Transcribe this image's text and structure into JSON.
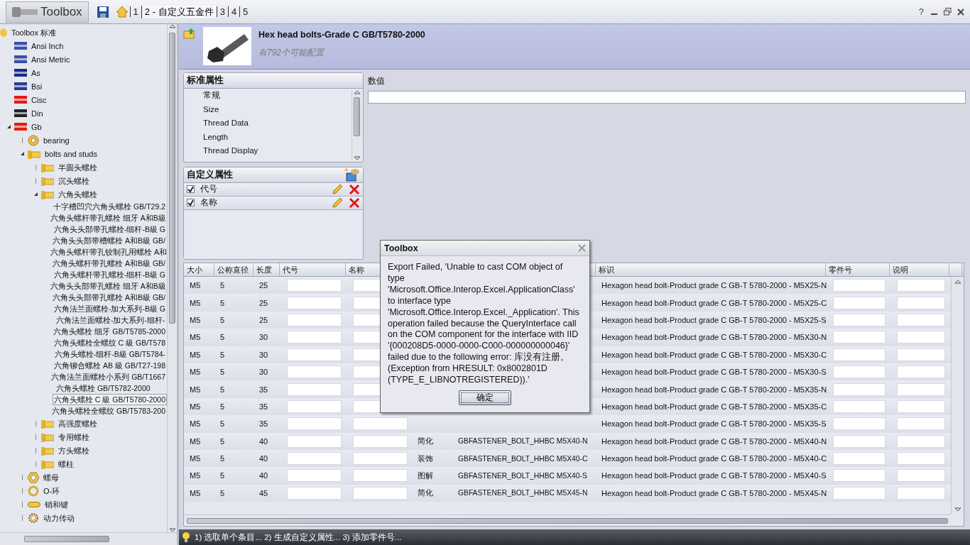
{
  "app": {
    "title": "Toolbox",
    "breadcrumbs": [
      {
        "label": "1",
        "selected": false
      },
      {
        "label": "2 - 自定义五金件",
        "selected": true
      },
      {
        "label": "3",
        "selected": false
      },
      {
        "label": "4",
        "selected": false
      },
      {
        "label": "5",
        "selected": false
      }
    ],
    "help": "?"
  },
  "tree": [
    {
      "label": "Toolbox 标准",
      "kind": "root",
      "expanded": true,
      "selected": false,
      "children": [
        {
          "label": "Ansi Inch",
          "kind": "flag",
          "color": "#3a4fa8",
          "selected": false
        },
        {
          "label": "Ansi Metric",
          "kind": "flag",
          "color": "#3a4fa8",
          "selected": false
        },
        {
          "label": "As",
          "kind": "flag",
          "color": "#1c2a8c",
          "selected": false
        },
        {
          "label": "Bsi",
          "kind": "flag",
          "color": "#2a3a90",
          "selected": false
        },
        {
          "label": "Cisc",
          "kind": "flag",
          "color": "#e01a1a",
          "selected": false
        },
        {
          "label": "Din",
          "kind": "flag",
          "color": "#222222",
          "selected": false
        },
        {
          "label": "Gb",
          "kind": "flag",
          "color": "#e02010",
          "expanded": true,
          "selected": false,
          "children": [
            {
              "label": "bearing",
              "kind": "bearing",
              "expanded": false,
              "selected": false
            },
            {
              "label": "bolts and studs",
              "kind": "folder",
              "expanded": true,
              "selected": false,
              "children": [
                {
                  "label": "半圆头螺栓",
                  "kind": "folder",
                  "expanded": false,
                  "selected": false
                },
                {
                  "label": "沉头螺栓",
                  "kind": "folder",
                  "expanded": false,
                  "selected": false
                },
                {
                  "label": "六角头螺栓",
                  "kind": "folder",
                  "expanded": true,
                  "selected": false,
                  "children": [
                    {
                      "label": "十字槽凹穴六角头螺栓 GB/T29.2",
                      "kind": "part",
                      "selected": false
                    },
                    {
                      "label": "六角头螺杆带孔螺栓 细牙 A和B級",
                      "kind": "part",
                      "selected": false
                    },
                    {
                      "label": "六角头头部带孔螺栓-细杆-B級 G",
                      "kind": "part",
                      "selected": false
                    },
                    {
                      "label": "六角头头部带槽螺栓 A和B級 GB/",
                      "kind": "part",
                      "selected": false
                    },
                    {
                      "label": "六角头螺杆带孔铰制孔用螺栓 A和",
                      "kind": "part",
                      "selected": false
                    },
                    {
                      "label": "六角头螺杆带孔螺栓 A和B級 GB/",
                      "kind": "part",
                      "selected": false
                    },
                    {
                      "label": "六角头螺杆带孔螺栓-细杆-B級 G",
                      "kind": "part",
                      "selected": false
                    },
                    {
                      "label": "六角头头部带孔螺栓 细牙 A和B級",
                      "kind": "part",
                      "selected": false
                    },
                    {
                      "label": "六角头头部带孔螺栓 A和B級 GB/",
                      "kind": "part",
                      "selected": false
                    },
                    {
                      "label": "六角法兰面螺栓-加大系列-B級 G",
                      "kind": "part",
                      "selected": false
                    },
                    {
                      "label": "六角法兰面螺栓-加大系列-细杆-",
                      "kind": "part",
                      "selected": false
                    },
                    {
                      "label": "六角头螺栓 细牙 GB/T5785-2000",
                      "kind": "part",
                      "selected": false
                    },
                    {
                      "label": "六角头螺栓全螺纹 C 級 GB/T578",
                      "kind": "part",
                      "selected": false
                    },
                    {
                      "label": "六角头螺栓-细杆-B級 GB/T5784-",
                      "kind": "part",
                      "selected": false
                    },
                    {
                      "label": "六角铆合螺栓 AB 級 GB/T27-198",
                      "kind": "part",
                      "selected": false
                    },
                    {
                      "label": "六角法兰面螺栓小系列 GB/T1667",
                      "kind": "part",
                      "selected": false
                    },
                    {
                      "label": "六角头螺栓 GB/T5782-2000",
                      "kind": "part",
                      "selected": false
                    },
                    {
                      "label": "六角头螺栓 C 級 GB/T5780-2000",
                      "kind": "part",
                      "selected": true
                    },
                    {
                      "label": "六角头螺栓全螺纹 GB/T5783-200",
                      "kind": "part",
                      "selected": false
                    }
                  ]
                },
                {
                  "label": "高强度螺栓",
                  "kind": "folder",
                  "expanded": false,
                  "selected": false
                },
                {
                  "label": "专用螺栓",
                  "kind": "folder",
                  "expanded": false,
                  "selected": false
                },
                {
                  "label": "方头螺栓",
                  "kind": "folder",
                  "expanded": false,
                  "selected": false
                },
                {
                  "label": "螺柱",
                  "kind": "folder",
                  "expanded": false,
                  "selected": false
                }
              ]
            },
            {
              "label": "螺母",
              "kind": "nut",
              "expanded": false,
              "selected": false
            },
            {
              "label": "O-环",
              "kind": "ring",
              "expanded": false,
              "selected": false
            },
            {
              "label": "销和键",
              "kind": "pin",
              "expanded": false,
              "selected": false
            },
            {
              "label": "动力传动",
              "kind": "gear",
              "expanded": false,
              "selected": false
            }
          ]
        }
      ]
    }
  ],
  "product": {
    "title": "Hex head bolts-Grade C GB/T5780-2000",
    "subtitle": "有792个可能配置"
  },
  "standard_properties": {
    "title": "标准属性",
    "items": [
      "常规",
      "Size",
      "Thread Data",
      "Length",
      "Thread Display"
    ]
  },
  "value_field": {
    "label": "数值"
  },
  "custom_properties": {
    "title": "自定义属性",
    "items": [
      {
        "label": "代号",
        "checked": true
      },
      {
        "label": "名称",
        "checked": true
      }
    ]
  },
  "table": {
    "columns": [
      "大小",
      "公称直径",
      "长度",
      "代号",
      "名称",
      "",
      "",
      "标识",
      "零件号",
      "说明"
    ],
    "rows": [
      {
        "size": "M5",
        "diameter": "5",
        "length": "25",
        "mark": "Hexagon head bolt-Product grade C GB-T 5780-2000 - M5X25-N"
      },
      {
        "size": "M5",
        "diameter": "5",
        "length": "25",
        "mark": "Hexagon head bolt-Product grade C GB-T 5780-2000 - M5X25-C"
      },
      {
        "size": "M5",
        "diameter": "5",
        "length": "25",
        "mark": "Hexagon head bolt-Product grade C GB-T 5780-2000 - M5X25-S"
      },
      {
        "size": "M5",
        "diameter": "5",
        "length": "30",
        "mark": "Hexagon head bolt-Product grade C GB-T 5780-2000 - M5X30-N"
      },
      {
        "size": "M5",
        "diameter": "5",
        "length": "30",
        "mark": "Hexagon head bolt-Product grade C GB-T 5780-2000 - M5X30-C"
      },
      {
        "size": "M5",
        "diameter": "5",
        "length": "30",
        "mark": "Hexagon head bolt-Product grade C GB-T 5780-2000 - M5X30-S"
      },
      {
        "size": "M5",
        "diameter": "5",
        "length": "35",
        "mark": "Hexagon head bolt-Product grade C GB-T 5780-2000 - M5X35-N"
      },
      {
        "size": "M5",
        "diameter": "5",
        "length": "35",
        "mark": "Hexagon head bolt-Product grade C GB-T 5780-2000 - M5X35-C"
      },
      {
        "size": "M5",
        "diameter": "5",
        "length": "35",
        "mark": "Hexagon head bolt-Product grade C GB-T 5780-2000 - M5X35-S"
      },
      {
        "size": "M5",
        "diameter": "5",
        "length": "40",
        "display": "简化",
        "config": "GBFASTENER_BOLT_HHBC M5X40-N",
        "mark": "Hexagon head bolt-Product grade C GB-T 5780-2000 - M5X40-N"
      },
      {
        "size": "M5",
        "diameter": "5",
        "length": "40",
        "display": "装饰",
        "config": "GBFASTENER_BOLT_HHBC M5X40-C",
        "mark": "Hexagon head bolt-Product grade C GB-T 5780-2000 - M5X40-C"
      },
      {
        "size": "M5",
        "diameter": "5",
        "length": "40",
        "display": "图解",
        "config": "GBFASTENER_BOLT_HHBC M5X40-S",
        "mark": "Hexagon head bolt-Product grade C GB-T 5780-2000 - M5X40-S"
      },
      {
        "size": "M5",
        "diameter": "5",
        "length": "45",
        "display": "简化",
        "config": "GBFASTENER_BOLT_HHBC M5X45-N",
        "mark": "Hexagon head bolt-Product grade C GB-T 5780-2000 - M5X45-N"
      }
    ]
  },
  "status_bar": {
    "text": "1) 选取单个条目... 2) 生成自定义属性... 3) 添加零件号..."
  },
  "dialog": {
    "title": "Toolbox",
    "message": "Export Failed, 'Unable to cast COM object of type 'Microsoft.Office.Interop.Excel.ApplicationClass' to interface type 'Microsoft.Office.Interop.Excel._Application'. This operation failed because the QueryInterface call on the COM component for the interface with IID '{000208D5-0000-0000-C000-000000000046}' failed due to the following error: 库没有注册。 (Exception from HRESULT: 0x8002801D (TYPE_E_LIBNOTREGISTERED)).'",
    "button": "确定"
  }
}
